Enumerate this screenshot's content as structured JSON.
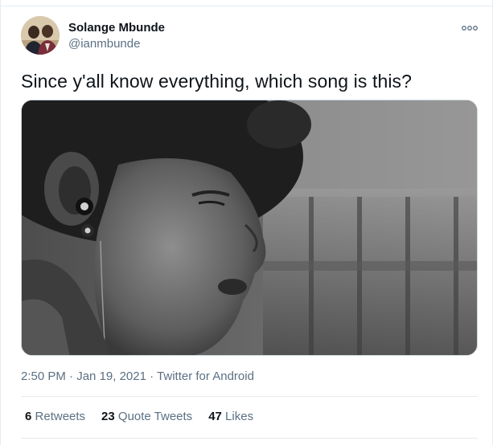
{
  "author": {
    "display_name": "Solange Mbunde",
    "handle": "@ianmbunde",
    "avatar_icon": "profile-photo-two-people"
  },
  "more_icon": "more-horizontal-icon",
  "tweet": {
    "text": "Since y'all know everything, which song is this?",
    "media_description_icon": "photo"
  },
  "meta": {
    "time": "2:50 PM",
    "separator1": " · ",
    "date": "Jan 19, 2021",
    "separator2": " · ",
    "source": "Twitter for Android"
  },
  "stats": {
    "retweets": {
      "count": "6",
      "label": "Retweets"
    },
    "quote_tweets": {
      "count": "23",
      "label": "Quote Tweets"
    },
    "likes": {
      "count": "47",
      "label": "Likes"
    }
  },
  "colors": {
    "primary_text": "#0f1419",
    "secondary_text": "#5b7083",
    "border": "#e6ecf0"
  }
}
